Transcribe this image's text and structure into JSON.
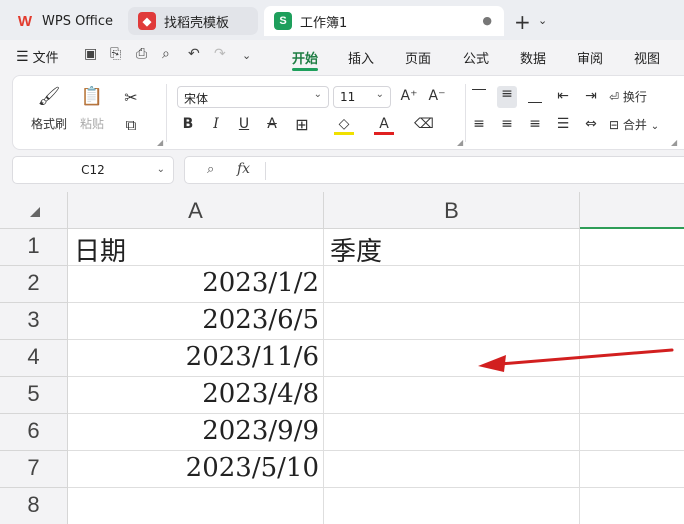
{
  "tabs": {
    "wps": "WPS Office",
    "template": "找稻壳模板",
    "workbook": "工作簿1",
    "workbook_icon": "S"
  },
  "menu": {
    "file": "文件",
    "items": [
      "开始",
      "插入",
      "页面",
      "公式",
      "数据",
      "审阅",
      "视图"
    ],
    "active": "开始"
  },
  "ribbon": {
    "format_painter": "格式刷",
    "paste": "粘贴",
    "font_name": "宋体",
    "font_size": "11",
    "wrap": "换行",
    "merge": "合并"
  },
  "formula_bar": {
    "cell_ref": "C12",
    "fx": "fx"
  },
  "columns": [
    "A",
    "B",
    ""
  ],
  "rows": [
    "1",
    "2",
    "3",
    "4",
    "5",
    "6",
    "7",
    "8"
  ],
  "cells": {
    "A1": "日期",
    "B1": "季度",
    "A2": "2023/1/2",
    "A3": "2023/6/5",
    "A4": "2023/11/6",
    "A5": "2023/4/8",
    "A6": "2023/9/9",
    "A7": "2023/5/10"
  },
  "colors": {
    "accent_green": "#1e9f5c",
    "arrow_red": "#d21f1f"
  }
}
